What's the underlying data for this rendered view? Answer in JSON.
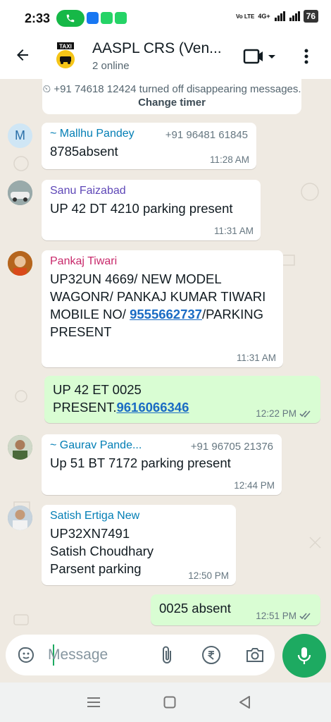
{
  "status": {
    "time": "2:33",
    "network": "4G+",
    "battery": "76",
    "volte": "Vo LTE"
  },
  "header": {
    "title": "AASPL CRS (Ven...",
    "subtitle": "2 online",
    "avatar_text": "TAXI"
  },
  "system_message": {
    "text": "+91 74618 12424 turned off disappearing messages.",
    "action": "Change timer"
  },
  "messages": [
    {
      "sender": "~ Mallhu Pandey",
      "sender_color": "#027eb5",
      "phone": "+91 96481 61845",
      "text": "8785absent",
      "time": "11:28 AM",
      "avatar_letter": "M"
    },
    {
      "sender": "Sanu Faizabad",
      "sender_color": "#5e47b7",
      "text": "UP 42 DT 4210 parking present",
      "time": "11:31 AM"
    },
    {
      "sender": "Pankaj Tiwari",
      "sender_color": "#c8296b",
      "text_before": "UP32UN 4669/ NEW MODEL WAGONR/ PANKAJ KUMAR TIWARI MOBILE NO/ ",
      "link": "9555662737",
      "text_after": "/PARKING PRESENT",
      "time": "11:31 AM"
    },
    {
      "outgoing": true,
      "text_before": "UP 42 ET 0025 PRESENT.",
      "link": "9616066346",
      "time": "12:22 PM"
    },
    {
      "sender": "~ Gaurav Pande...",
      "sender_color": "#027eb5",
      "phone": "+91 96705 21376",
      "text": "Up 51 BT 7172 parking present",
      "time": "12:44 PM"
    },
    {
      "sender": "Satish Ertiga New",
      "sender_color": "#027eb5",
      "line1": "UP32XN7491",
      "line2": "Satish Choudhary",
      "line3": "Parsent parking",
      "time": "12:50 PM"
    },
    {
      "outgoing": true,
      "text": "0025 absent",
      "time": "12:51 PM"
    }
  ],
  "composer": {
    "placeholder": "Message"
  },
  "colors": {
    "accent": "#1daa61",
    "outgoing_bubble": "#d9fdd3",
    "chat_bg": "#efeae2",
    "link": "#1a6bc4"
  },
  "icons": [
    "back-arrow-icon",
    "video-call-icon",
    "more-options-icon",
    "sticker-icon",
    "attach-icon",
    "rupee-icon",
    "camera-icon",
    "mic-icon",
    "read-ticks-icon",
    "timer-icon"
  ]
}
